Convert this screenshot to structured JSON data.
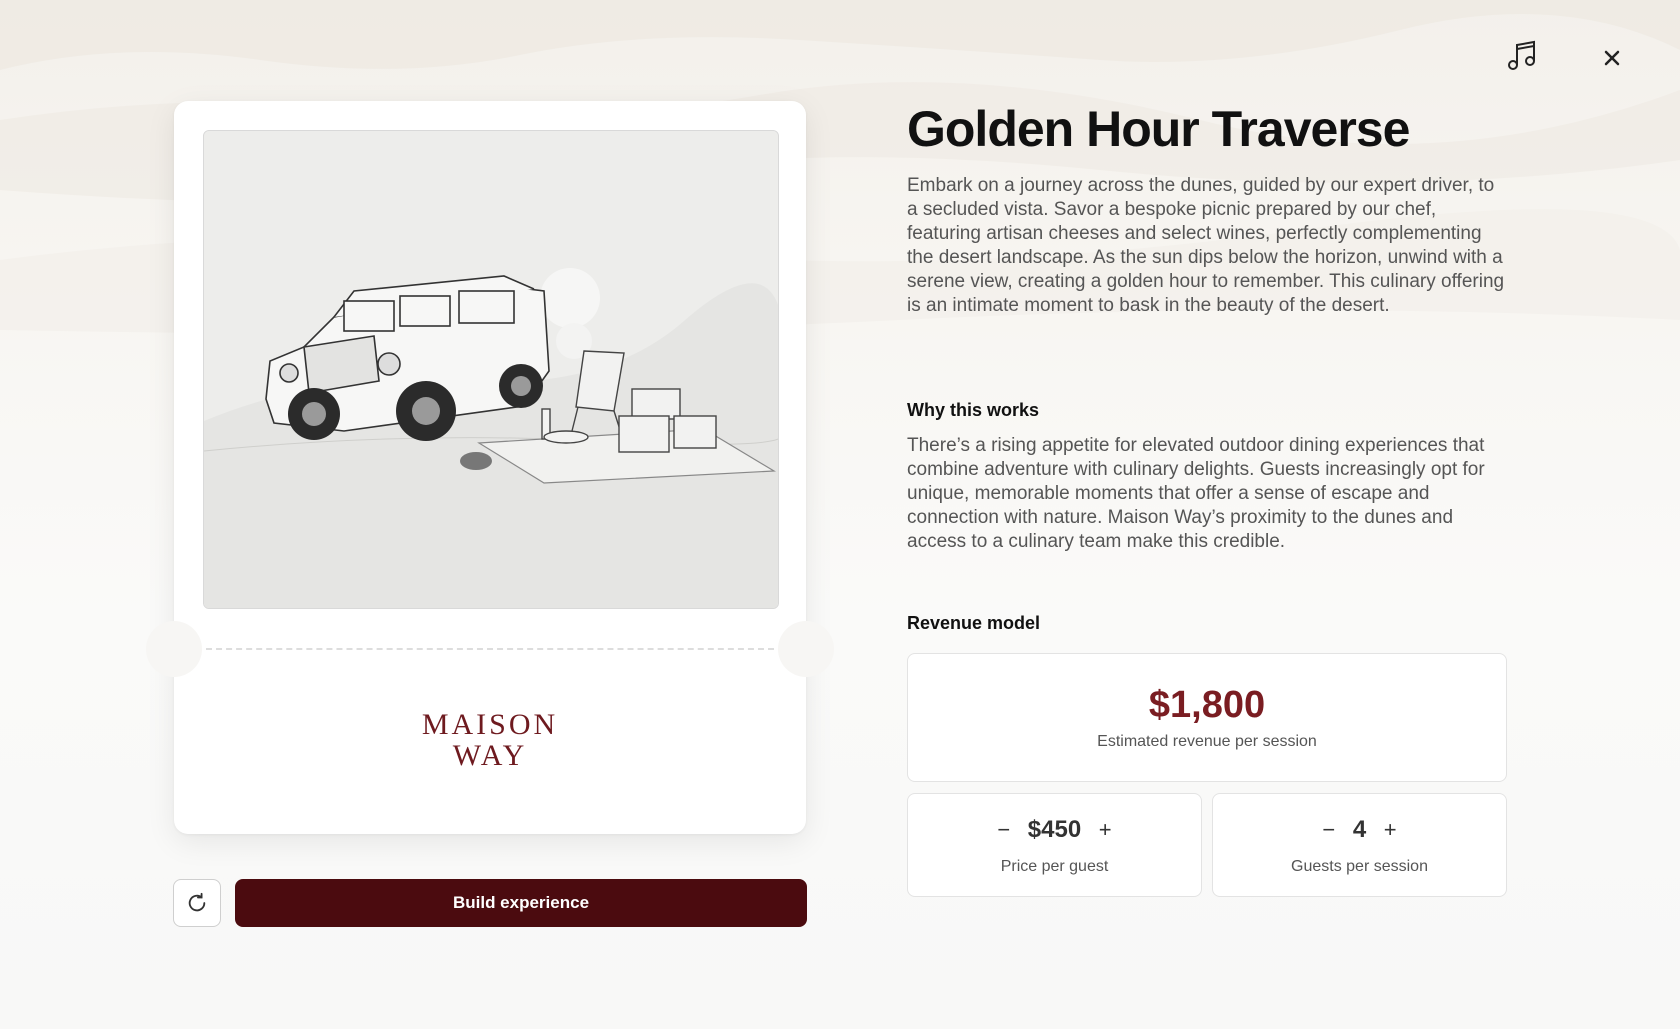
{
  "experience": {
    "title": "Golden Hour Traverse",
    "description": "Embark on a journey across the dunes, guided by our expert driver, to a secluded vista. Savor a bespoke picnic prepared by our chef, featuring artisan cheeses and select wines, perfectly complementing the desert landscape. As the sun dips below the horizon, unwind with a serene view, creating a golden hour to remember. This culinary offering is an intimate moment to bask in the beauty of the desert."
  },
  "why": {
    "heading": "Why this works",
    "text": "There’s a rising appetite for elevated outdoor dining experiences that combine adventure with culinary delights. Guests increasingly opt for unique, memorable moments that offer a sense of escape and connection with nature. Maison Way’s proximity to the dunes and access to a culinary team make this credible."
  },
  "revenue": {
    "heading": "Revenue model",
    "total_value": "$1,800",
    "total_label": "Estimated revenue per session",
    "price": {
      "value": "$450",
      "label": "Price per guest",
      "minus": "−",
      "plus": "+"
    },
    "guests": {
      "value": "4",
      "label": "Guests per session",
      "minus": "−",
      "plus": "+"
    }
  },
  "brand": {
    "line1": "MAISON",
    "line2": "WAY"
  },
  "actions": {
    "build_label": "Build experience"
  },
  "icons": {
    "music": "music-note-icon",
    "close": "close-icon",
    "refresh": "refresh-icon"
  },
  "colors": {
    "accent": "#4b0b0f",
    "brand": "#6e1a1f",
    "revenue": "#7a1d22"
  }
}
